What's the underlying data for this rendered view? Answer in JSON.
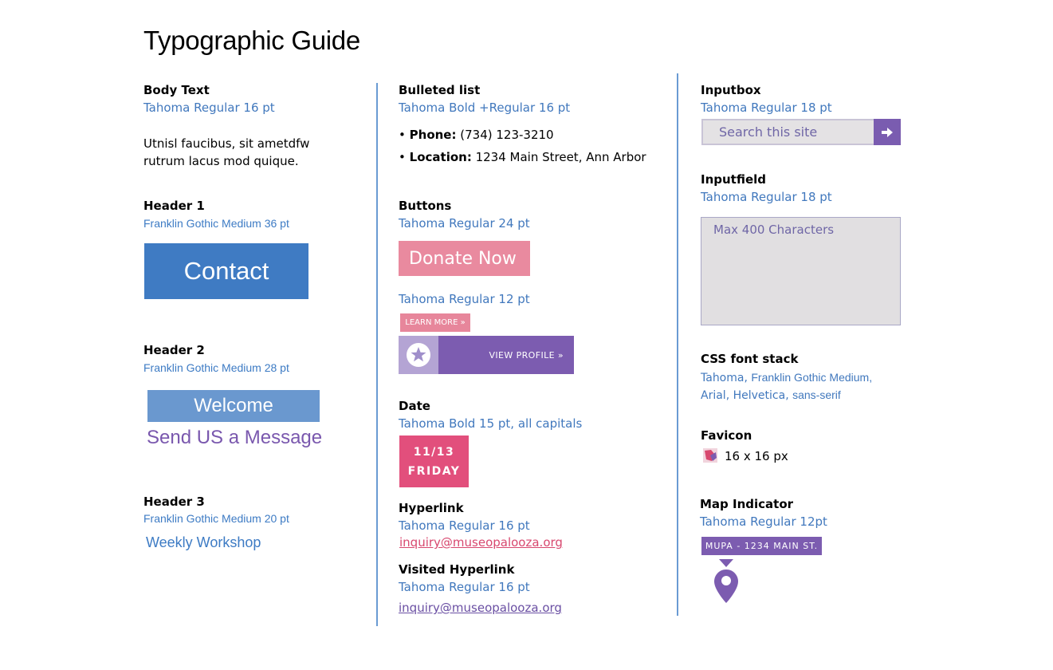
{
  "title": "Typographic Guide",
  "col1": {
    "body_text": {
      "label": "Body Text",
      "spec": "Tahoma Regular 16 pt",
      "line1": "Utnisl faucibus, sit ametdfw",
      "line2": "rutrum lacus mod quique."
    },
    "header1": {
      "label": "Header 1",
      "spec": "Franklin Gothic Medium 36 pt",
      "sample": "Contact"
    },
    "header2": {
      "label": "Header 2",
      "spec": "Franklin Gothic Medium 28 pt",
      "sample_box": "Welcome",
      "sample_text": "Send US a Message"
    },
    "header3": {
      "label": "Header 3",
      "spec": "Franklin Gothic Medium 20 pt",
      "sample": "Weekly Workshop"
    }
  },
  "col2": {
    "bulleted": {
      "label": "Bulleted list",
      "spec": "Tahoma Bold +Regular 16 pt",
      "items": [
        {
          "bullet": "•",
          "key": "Phone:",
          "value": "(734) 123-3210"
        },
        {
          "bullet": "•",
          "key": "Location:",
          "value": "1234 Main Street, Ann Arbor"
        }
      ]
    },
    "buttons": {
      "label": "Buttons",
      "spec_large": "Tahoma Regular 24 pt",
      "donate": "Donate Now",
      "spec_small": "Tahoma Regular 12 pt",
      "learn_more": "LEARN MORE »",
      "view_profile": "VIEW  PROFILE »"
    },
    "date": {
      "label": "Date",
      "spec": "Tahoma Bold 15 pt, all capitals",
      "line1": "11/13",
      "line2": "FRIDAY"
    },
    "hyperlink": {
      "label": "Hyperlink",
      "spec": "Tahoma Regular 16 pt",
      "link": "inquiry@museopalooza.org"
    },
    "visited": {
      "label": "Visited Hyperlink",
      "spec": "Tahoma Regular 16 pt",
      "link": "inquiry@museopalooza.org"
    }
  },
  "col3": {
    "inputbox": {
      "label": "Inputbox",
      "spec": "Tahoma Regular 18 pt",
      "placeholder": "Search this site"
    },
    "inputfield": {
      "label": "Inputfield",
      "spec": "Tahoma Regular 18 pt",
      "placeholder": "Max 400 Characters"
    },
    "font_stack": {
      "label": "CSS font stack",
      "tahoma": "Tahoma,",
      "franklin": "Franklin Gothic Medium,",
      "arial": "Arial,",
      "helvetica": "Helvetica,",
      "sans": "sans-serif"
    },
    "favicon": {
      "label": "Favicon",
      "size": "16 x 16 px"
    },
    "map": {
      "label": "Map Indicator",
      "spec": "Tahoma Regular 12pt",
      "tag": "MUPA - 1234 MAIN ST."
    }
  },
  "colors": {
    "blue": "#3f7bc3",
    "purple": "#7c5cb0",
    "pink": "#e98a9f",
    "magenta": "#e24f7c",
    "link_pink": "#d8486f",
    "visited_purple": "#6a4fa3"
  }
}
